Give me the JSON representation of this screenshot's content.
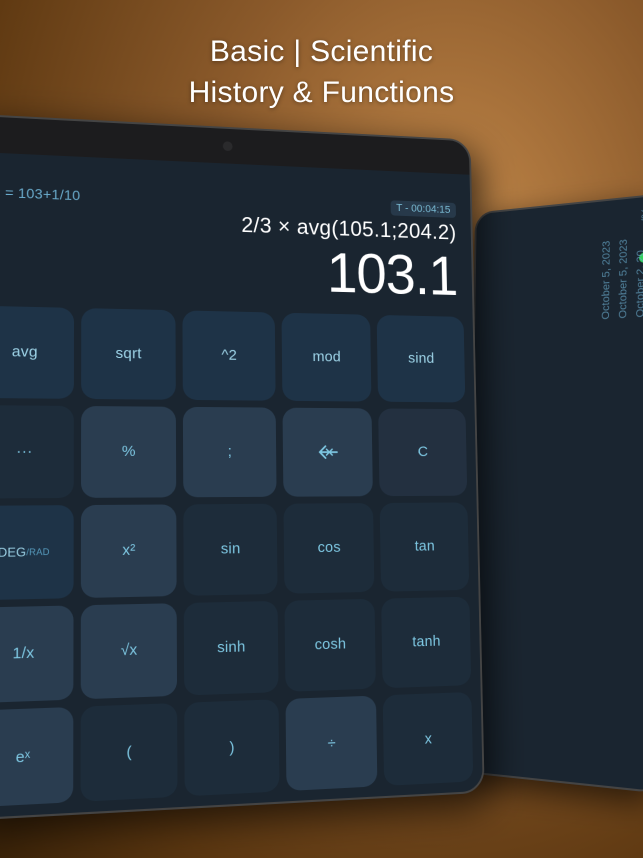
{
  "title": {
    "line1": "Basic | Scientific",
    "line2": "History & Functions"
  },
  "tablet": {
    "history_icon": "◎",
    "history_expr": "= 103+1/10",
    "timer": "T - 00:04:15",
    "main_expr": "2/3 × avg(105.1;204.2)",
    "result": "103.1",
    "corner": "Γ"
  },
  "keypad": {
    "rows": [
      [
        "avg",
        "sqrt",
        "^2",
        "mod",
        "sind"
      ],
      [
        "...",
        "%",
        ";",
        "⌫",
        "C"
      ],
      [
        "DEG/RAD",
        "x²",
        "sin",
        "cos",
        "tan"
      ],
      [
        "1/x",
        "√x",
        "sinh",
        "cosh",
        "tanh"
      ],
      [
        "eˣ",
        "(",
        ")",
        "÷",
        "x"
      ]
    ]
  },
  "right_panel": {
    "dates": [
      "5, 2023",
      "ber 5, 2023",
      "ctober 2, 20"
    ],
    "percent_label": "%/"
  }
}
